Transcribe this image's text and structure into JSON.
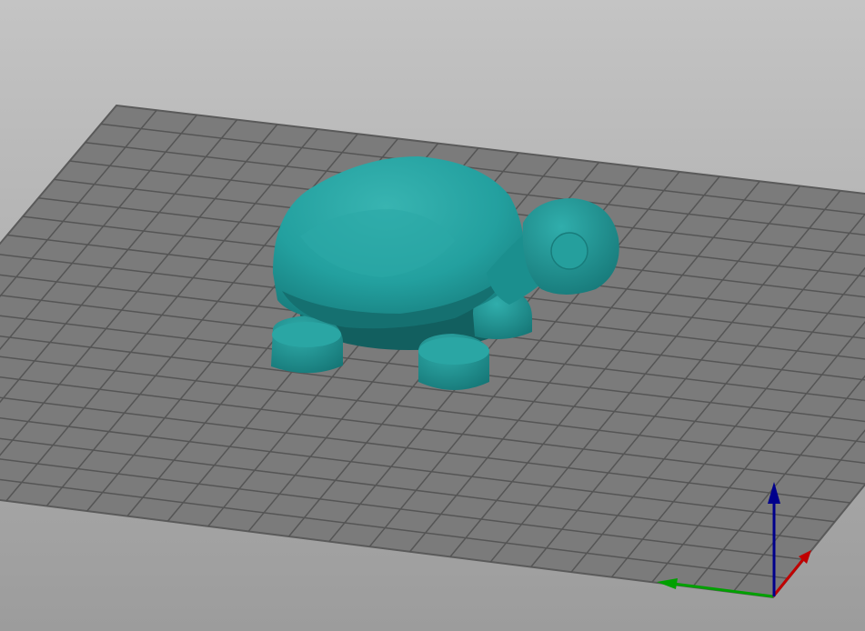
{
  "viewport": {
    "object": "turtle-model",
    "colors": {
      "model": "#1f9a9a",
      "model_dark": "#157474",
      "model_light": "#33b0ae",
      "bed": "#7b7b7b",
      "grid_line": "#555555",
      "axis_x": "#c00000",
      "axis_y": "#00a000",
      "axis_z": "#00008c"
    },
    "grid": {
      "columns": 24,
      "rows": 20
    }
  }
}
